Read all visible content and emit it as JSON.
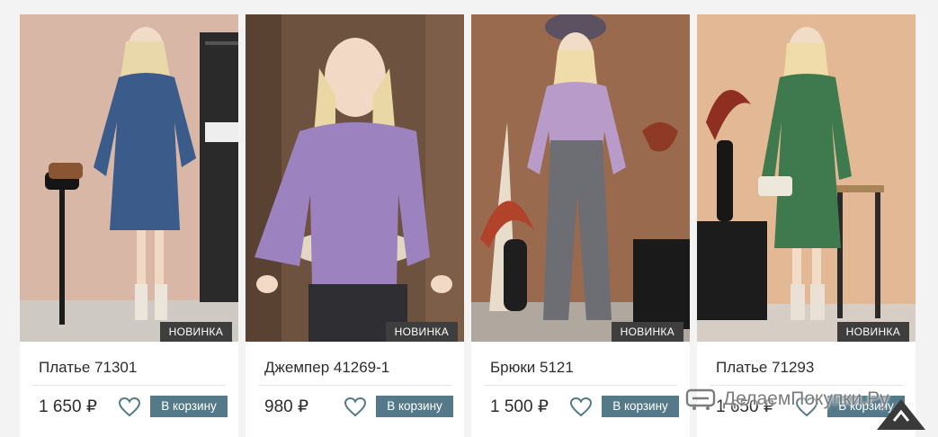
{
  "products": [
    {
      "name": "Платье 71301",
      "price": "1 650 ₽",
      "badge": "НОВИНКА",
      "cart_label": "В корзину"
    },
    {
      "name": "Джемпер 41269-1",
      "price": "980 ₽",
      "badge": "НОВИНКА",
      "cart_label": "В корзину"
    },
    {
      "name": "Брюки 5121",
      "price": "1 500 ₽",
      "badge": "НОВИНКА",
      "cart_label": "В корзину"
    },
    {
      "name": "Платье 71293",
      "price": "1 650 ₽",
      "badge": "НОВИНКА",
      "cart_label": "В корзину"
    }
  ],
  "watermark": {
    "text": "ДелаемПокупки.Ру"
  },
  "colors": {
    "cart_button": "#547a89",
    "badge": "#3e3e3e",
    "heart": "#547a89"
  },
  "icons": {
    "favorite": "heart-icon",
    "watermark": "cart-logo-icon"
  }
}
